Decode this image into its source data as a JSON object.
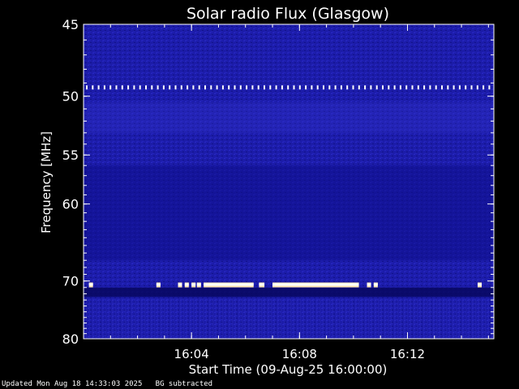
{
  "chart_data": {
    "type": "heatmap",
    "title": "Solar radio Flux (Glasgow)",
    "xlabel": "Start Time (09-Aug-25 16:00:00)",
    "ylabel": "Frequency [MHz]",
    "x_range_minutes": [
      0,
      15.2
    ],
    "x_ticks": [
      {
        "minute": 4,
        "label": "16:04"
      },
      {
        "minute": 8,
        "label": "16:08"
      },
      {
        "minute": 12,
        "label": "16:12"
      }
    ],
    "y_range_mhz": [
      45,
      80
    ],
    "y_scale": "reciprocal",
    "y_ticks": [
      {
        "mhz": 45,
        "label": "45"
      },
      {
        "mhz": 50,
        "label": "50"
      },
      {
        "mhz": 55,
        "label": "55"
      },
      {
        "mhz": 60,
        "label": "60"
      },
      {
        "mhz": 70,
        "label": "70"
      },
      {
        "mhz": 80,
        "label": "80"
      }
    ],
    "background_color": "#1a1aa8",
    "interference_bands": [
      {
        "mhz": 49.3,
        "color": "#ffffff",
        "segments": [
          [
            0,
            15.2
          ]
        ],
        "dashed": true
      },
      {
        "mhz": 70.6,
        "color": "#ffffff",
        "dashed": false,
        "segments": [
          [
            0.2,
            0.35
          ],
          [
            2.7,
            2.85
          ],
          [
            3.5,
            3.65
          ],
          [
            3.75,
            3.9
          ],
          [
            4.0,
            4.15
          ],
          [
            4.2,
            4.35
          ],
          [
            4.45,
            6.3
          ],
          [
            6.5,
            6.7
          ],
          [
            7.0,
            10.2
          ],
          [
            10.5,
            10.65
          ],
          [
            10.75,
            10.9
          ],
          [
            14.6,
            14.75
          ]
        ]
      }
    ]
  },
  "footer": {
    "updated": "Updated Mon Aug 18 14:33:03 2025",
    "note": "BG subtracted"
  }
}
